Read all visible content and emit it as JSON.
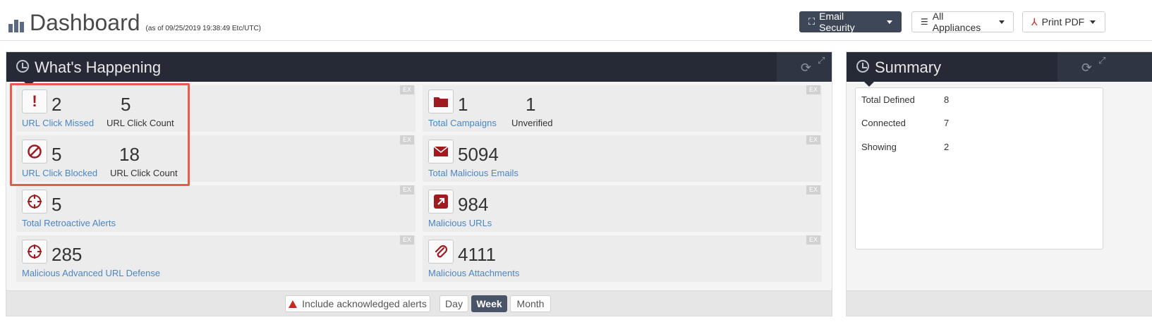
{
  "header": {
    "title": "Dashboard",
    "as_of_prefix": "(as of",
    "as_of_time": "09/25/2019 19:38:49",
    "as_of_suffix": "Etc/UTC)",
    "buttons": {
      "email_security": "Email Security",
      "all_appliances": "All Appliances",
      "print_pdf": "Print PDF"
    }
  },
  "whats_happening": {
    "title": "What's Happening",
    "ex_label": "EX",
    "cards": [
      {
        "icon": "exclamation-icon",
        "value": "2",
        "label": "URL Click Missed",
        "value2": "5",
        "label2": "URL Click Count"
      },
      {
        "icon": "folder-icon",
        "value": "1",
        "label": "Total Campaigns",
        "value2": "1",
        "label2": "Unverified"
      },
      {
        "icon": "blocked-icon",
        "value": "5",
        "label": "URL Click Blocked",
        "value2": "18",
        "label2": "URL Click Count"
      },
      {
        "icon": "envelope-icon",
        "value": "5094",
        "label": "Total Malicious Emails"
      },
      {
        "icon": "crosshair-icon",
        "value": "5",
        "label": "Total Retroactive Alerts"
      },
      {
        "icon": "external-link-icon",
        "value": "984",
        "label": "Malicious URLs"
      },
      {
        "icon": "crosshair-icon",
        "value": "285",
        "label": "Malicious Advanced URL Defense"
      },
      {
        "icon": "paperclip-icon",
        "value": "4111",
        "label": "Malicious Attachments"
      }
    ],
    "footer": {
      "include_ack": "Include acknowledged alerts",
      "day": "Day",
      "week": "Week",
      "month": "Month",
      "selected": "Week"
    }
  },
  "summary": {
    "title": "Summary",
    "rows": [
      {
        "label": "Total Defined",
        "value": "8"
      },
      {
        "label": "Connected",
        "value": "7"
      },
      {
        "label": "Showing",
        "value": "2"
      }
    ]
  },
  "colors": {
    "accent_red": "#9e1b20",
    "link_blue": "#4a86c5",
    "panel_header": "#252a36",
    "highlight": "#e9594c"
  }
}
